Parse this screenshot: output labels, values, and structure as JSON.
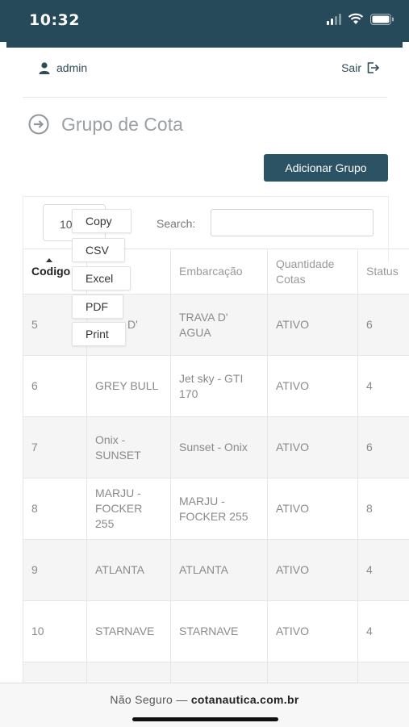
{
  "status_bar": {
    "time": "10:32"
  },
  "header": {
    "username": "admin",
    "logout_label": "Sair"
  },
  "page": {
    "title": "Grupo de Cota",
    "add_button_label": "Adicionar Grupo"
  },
  "controls": {
    "length_value": "10",
    "search_label": "Search:",
    "search_placeholder": ""
  },
  "export_menu": [
    "Copy",
    "CSV",
    "Excel",
    "PDF",
    "Print"
  ],
  "table": {
    "headers": [
      "Codigo",
      "",
      "Embarcação",
      "Quantidade Cotas",
      "Status"
    ],
    "rows": [
      [
        "5",
        "D'",
        "TRAVA D' AGUA",
        "ATIVO",
        "6"
      ],
      [
        "6",
        "GREY BULL",
        "Jet sky - GTI 170",
        "ATIVO",
        "4"
      ],
      [
        "7",
        "Onix - SUNSET",
        "Sunset - Onix",
        "ATIVO",
        "6"
      ],
      [
        "8",
        "MARJU - FOCKER 255",
        "MARJU - FOCKER 255",
        "ATIVO",
        "8"
      ],
      [
        "9",
        "ATLANTA",
        "ATLANTA",
        "ATIVO",
        "4"
      ],
      [
        "10",
        "STARNAVE",
        "STARNAVE",
        "ATIVO",
        "4"
      ],
      [
        "",
        "",
        "",
        "",
        ""
      ]
    ]
  },
  "browser": {
    "insecure_label": "Não Seguro —",
    "domain": "cotanautica.com.br"
  },
  "colors": {
    "brand": "#274a5a",
    "button": "#2b5363"
  },
  "icons": [
    "user-icon",
    "logout-icon",
    "arrow-circle-right-icon",
    "wifi-icon",
    "battery-icon",
    "signal-icon"
  ]
}
